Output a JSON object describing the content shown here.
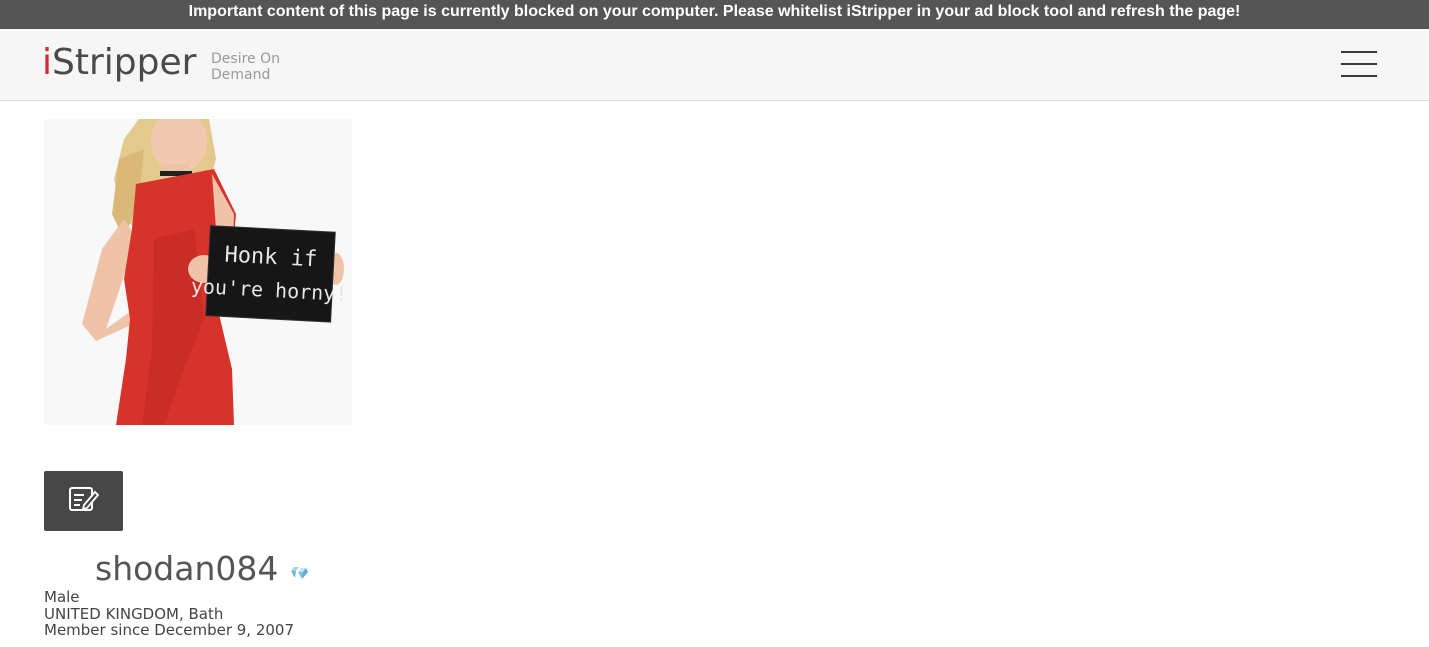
{
  "banner": {
    "text": "Important content of this page is currently blocked on your computer. Please whitelist iStripper in your ad block tool and refresh the page!"
  },
  "header": {
    "logo_i": "i",
    "logo_rest": "Stripper",
    "tagline": "Desire On Demand",
    "menu_icon": "hamburger-menu-icon"
  },
  "photo": {
    "sign_line1": "Honk if",
    "sign_line2": "you're horny!"
  },
  "edit_button_icon": "edit-note-icon",
  "profile": {
    "username": "shodan084",
    "badge_icon": "diamond-icon",
    "gender": "Male",
    "location": "UNITED KINGDOM, Bath",
    "member_since": "Member since December 9, 2007"
  },
  "colors": {
    "banner_bg": "#555555",
    "header_bg": "#f6f6f6",
    "brand_red": "#d6283d",
    "button_bg": "#474747",
    "dress_red": "#d8332b"
  }
}
